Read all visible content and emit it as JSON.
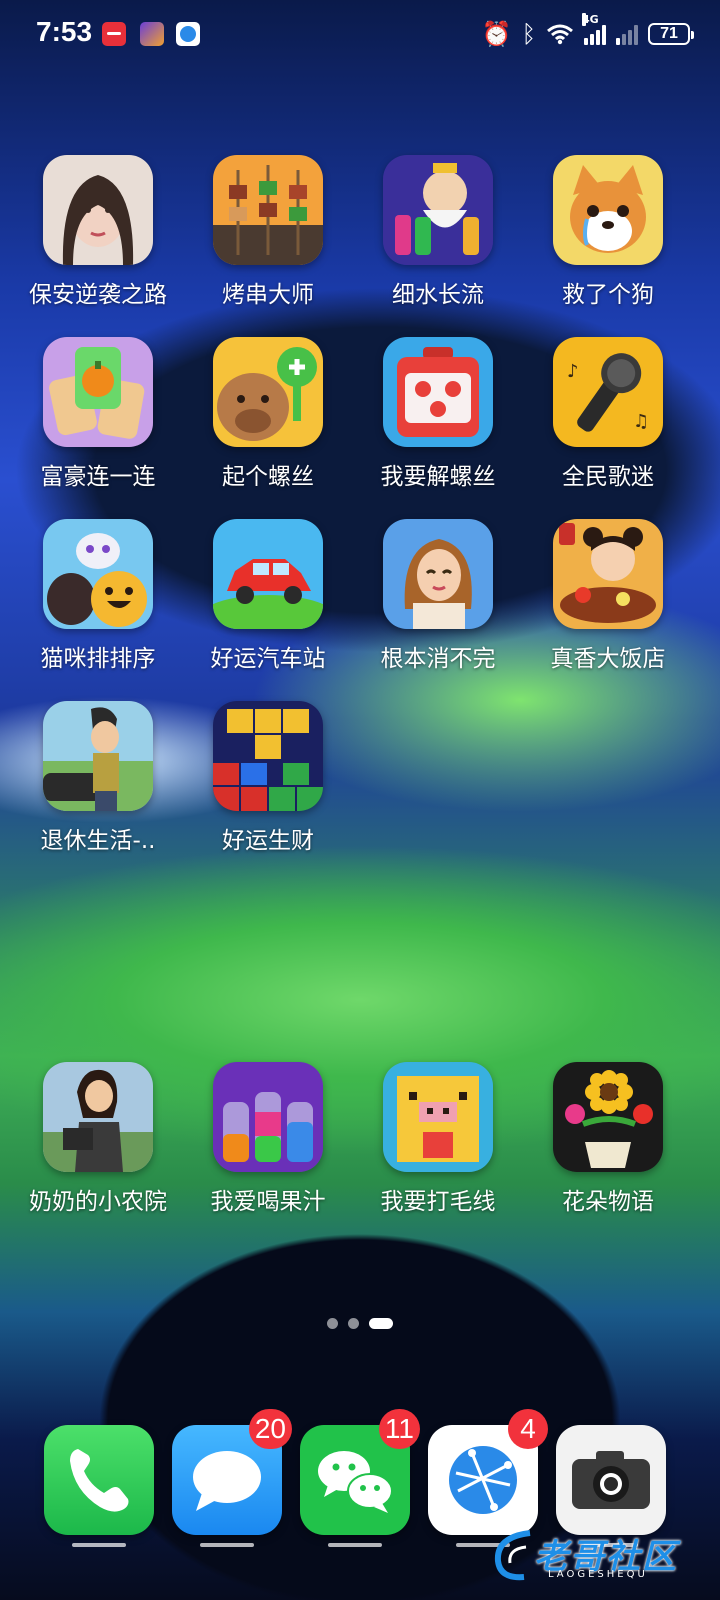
{
  "status_bar": {
    "time": "7:53",
    "notification_icons": [
      "huawei-icon",
      "game-icon",
      "browser-icon"
    ],
    "network_label": "4G",
    "battery": "71"
  },
  "apps": [
    {
      "label": "保安逆袭之路",
      "icon": "girl-portrait-icon"
    },
    {
      "label": "烤串大师",
      "icon": "skewers-icon"
    },
    {
      "label": "细水长流",
      "icon": "water-sort-icon"
    },
    {
      "label": "救了个狗",
      "icon": "shiba-dog-icon"
    },
    {
      "label": "富豪连一连",
      "icon": "pumpkin-cards-icon"
    },
    {
      "label": "起个螺丝",
      "icon": "capybara-screw-icon"
    },
    {
      "label": "我要解螺丝",
      "icon": "red-toolbox-icon"
    },
    {
      "label": "全民歌迷",
      "icon": "microphone-icon"
    },
    {
      "label": "猫咪排排序",
      "icon": "cats-icon"
    },
    {
      "label": "好运汽车站",
      "icon": "red-car-icon"
    },
    {
      "label": "根本消不完",
      "icon": "woman-portrait-icon"
    },
    {
      "label": "真香大饭店",
      "icon": "chef-girl-icon"
    },
    {
      "label": "退休生活-..",
      "icon": "retired-man-icon"
    },
    {
      "label": "好运生财",
      "icon": "block-puzzle-icon"
    }
  ],
  "dock_row_apps": [
    {
      "label": "奶奶的小农院",
      "icon": "businesswoman-icon"
    },
    {
      "label": "我爱喝果汁",
      "icon": "juice-bottles-icon"
    },
    {
      "label": "我要打毛线",
      "icon": "pixel-pig-icon"
    },
    {
      "label": "花朵物语",
      "icon": "flower-pot-icon"
    }
  ],
  "page_indicator": {
    "count": 3,
    "active": 3
  },
  "dock": [
    {
      "name": "phone",
      "icon": "phone-icon",
      "badge": ""
    },
    {
      "name": "messages",
      "icon": "messages-icon",
      "badge": "20"
    },
    {
      "name": "wechat",
      "icon": "wechat-icon",
      "badge": "11"
    },
    {
      "name": "browser",
      "icon": "browser-icon",
      "badge": "4"
    },
    {
      "name": "camera",
      "icon": "camera-icon",
      "badge": ""
    }
  ],
  "watermark": {
    "text": "老哥社区",
    "subtext": "LAOGESHEQU"
  }
}
